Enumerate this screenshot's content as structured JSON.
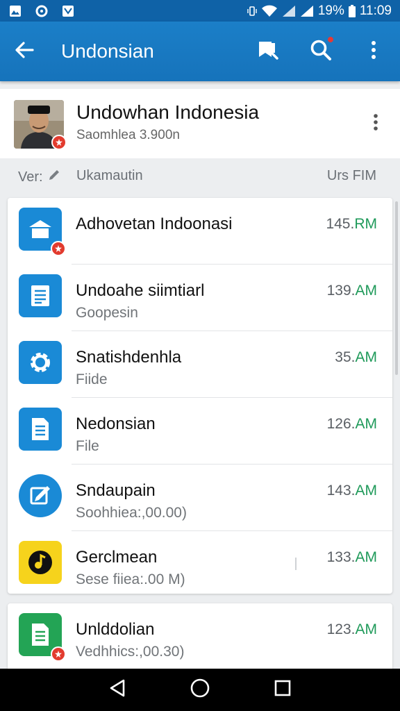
{
  "status_bar": {
    "battery": "19%",
    "time": "11:09"
  },
  "app_bar": {
    "title": "Undonsian",
    "icons": [
      "back-arrow-icon",
      "bookmark-search-icon",
      "search-icon",
      "more-vertical-icon"
    ]
  },
  "profile": {
    "name": "Undowhan Indonesia",
    "subtitle": "Saomhlea 3.900n"
  },
  "list_header": {
    "ver": "Ver:",
    "name": "Ukamautin",
    "size": "Urs FIM"
  },
  "files": [
    {
      "title": "Adhovetan Indoonasi",
      "subtitle": "",
      "time_num": "145.",
      "time_suffix": "RM",
      "icon": "home-icon",
      "color": "#1a8ad6",
      "badge": true
    },
    {
      "title": "Undoahe siimtiarl",
      "subtitle": "Goopesin",
      "time_num": "139.",
      "time_suffix": "AM",
      "icon": "document-icon",
      "color": "#1a8ad6",
      "badge": false
    },
    {
      "title": "Snatishdenhla",
      "subtitle": "Fiide",
      "time_num": "35.",
      "time_suffix": "AM",
      "icon": "gear-icon",
      "color": "#1a8ad6",
      "badge": false
    },
    {
      "title": "Nedonsian",
      "subtitle": "File",
      "time_num": "126.",
      "time_suffix": "AM",
      "icon": "file-icon",
      "color": "#1a8ad6",
      "badge": false
    },
    {
      "title": "Sndaupain",
      "subtitle": "Soohhiea:,00.00)",
      "time_num": "143.",
      "time_suffix": "AM",
      "icon": "edit-icon",
      "color": "#1a8ad6",
      "badge": false
    },
    {
      "title": "Gerclmean",
      "subtitle": "Sese fiiea:.00 M)",
      "time_num": "133.",
      "time_suffix": "AM",
      "icon": "music-note-icon",
      "color": "#f6d31c",
      "badge": false
    },
    {
      "title": "Unlddolian",
      "subtitle": "Vedhhics:,00.30)",
      "time_num": "123.",
      "time_suffix": "AM",
      "icon": "sheet-icon",
      "color": "#23a455",
      "badge": true
    }
  ],
  "nav_bar": {
    "icons": [
      "back-triangle-icon",
      "home-circle-icon",
      "recents-square-icon"
    ]
  }
}
